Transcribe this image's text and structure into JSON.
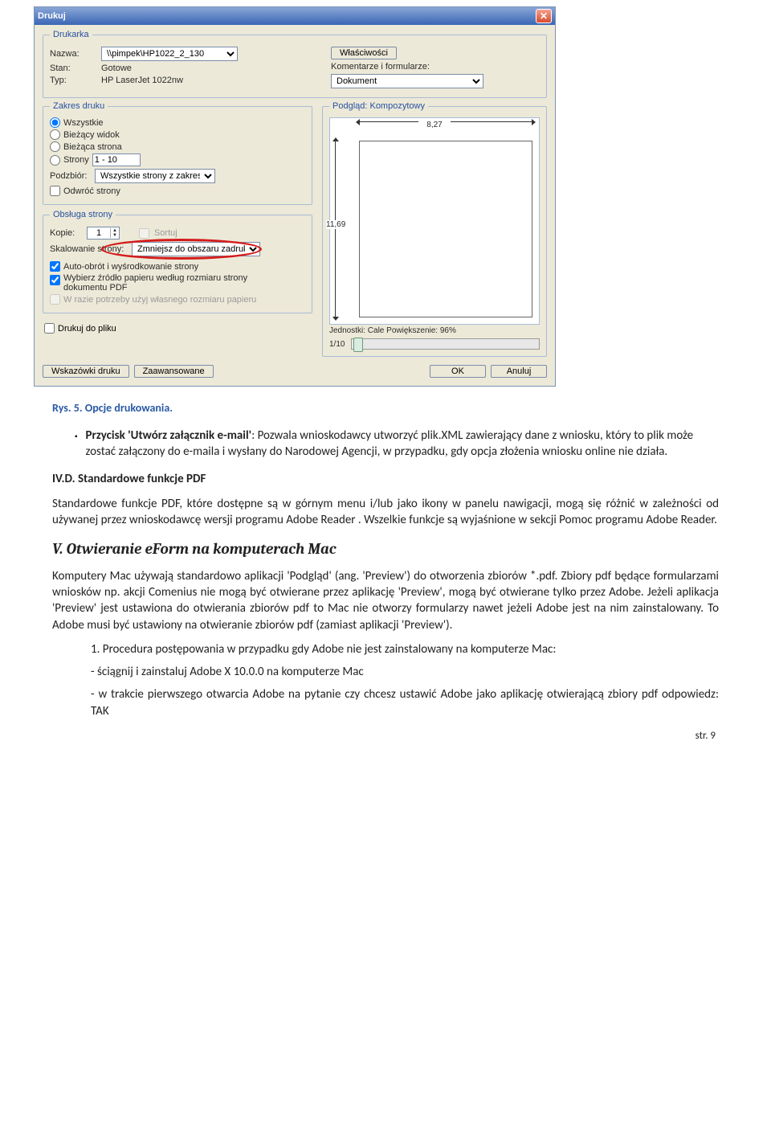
{
  "dialog": {
    "title": "Drukuj",
    "close_label": "✕",
    "printer": {
      "legend": "Drukarka",
      "name_lbl": "Nazwa:",
      "name_value": "\\\\pimpek\\HP1022_2_130",
      "state_lbl": "Stan:",
      "state_value": "Gotowe",
      "type_lbl": "Typ:",
      "type_value": "HP LaserJet 1022nw",
      "properties_btn": "Właściwości",
      "comments_lbl": "Komentarze i formularze:",
      "comments_value": "Dokument"
    },
    "range": {
      "legend": "Zakres druku",
      "all": "Wszystkie",
      "view": "Bieżący widok",
      "page": "Bieżąca strona",
      "pages_lbl": "Strony",
      "pages_value": "1 - 10",
      "subset_lbl": "Podzbiór:",
      "subset_value": "Wszystkie strony z zakresu",
      "reverse": "Odwróć strony"
    },
    "handling": {
      "legend": "Obsługa strony",
      "copies_lbl": "Kopie:",
      "copies_value": "1",
      "collate": "Sortuj",
      "scale_lbl": "Skalowanie strony:",
      "scale_value": "Zmniejsz do obszaru zadruku",
      "autorotate": "Auto-obrót i wyśrodkowanie strony",
      "papersource": "Wybierz źródło papieru według rozmiaru strony dokumentu PDF",
      "custompaper": "W razie potrzeby użyj własnego rozmiaru papieru"
    },
    "printtofile": "Drukuj do pliku",
    "preview": {
      "legend": "Podgląd: Kompozytowy",
      "width": "8,27",
      "height": "11,69",
      "units": "Jednostki: Cale Powiększenie:  96%",
      "page_counter": "1/10"
    },
    "tips_btn": "Wskazówki druku",
    "advanced_btn": "Zaawansowane",
    "ok_btn": "OK",
    "cancel_btn": "Anuluj"
  },
  "doc": {
    "caption": "Rys. 5.  Opcje drukowania.",
    "bullet_text_a": "Przycisk 'Utwórz załącznik e-mail'",
    "bullet_text_b": ": Pozwala wnioskodawcy utworzyć plik.XML zawierający dane z wniosku, który to plik może zostać załączony do e-maila i wysłany do Narodowej Agencji, w przypadku, gdy opcja złożenia wniosku online nie działa.",
    "sec_d": "IV.D. Standardowe funkcje PDF",
    "para_d": "Standardowe funkcje PDF, które dostępne są w górnym menu i/lub jako ikony w panelu nawigacji, mogą się różnić w zależności od używanej przez wnioskodawcę wersji programu Adobe Reader . Wszelkie funkcje są wyjaśnione w sekcji Pomoc programu Adobe Reader.",
    "sec_v": "V. Otwieranie eForm na komputerach Mac",
    "para_v": "Komputery Mac używają standardowo aplikacji 'Podgląd' (ang. 'Preview') do otworzenia zbiorów *.pdf. Zbiory pdf będące formularzami wniosków np. akcji Comenius nie mogą być otwierane przez aplikację 'Preview', mogą być otwierane tylko przez Adobe. Jeżeli aplikacja 'Preview' jest ustawiona do otwierania zbiorów pdf to Mac nie otworzy formularzy nawet jeżeli Adobe jest na nim zainstalowany. To Adobe musi być ustawiony na otwieranie zbiorów pdf (zamiast aplikacji 'Preview').",
    "step1": "1. Procedura postępowania w przypadku gdy Adobe nie jest zainstalowany na komputerze Mac:",
    "step1a": "- ściągnij i zainstaluj Adobe X 10.0.0 na komputerze Mac",
    "step1b": "- w trakcie pierwszego otwarcia Adobe na pytanie czy chcesz ustawić Adobe jako aplikację otwierającą zbiory pdf odpowiedz:  TAK",
    "page_num": "str. 9"
  }
}
